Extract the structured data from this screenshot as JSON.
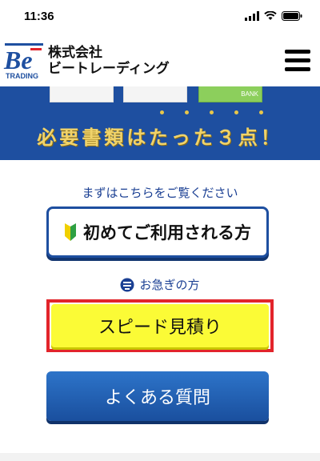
{
  "status_bar": {
    "time": "11:36",
    "icons": [
      "signal-icon",
      "wifi-icon",
      "battery-icon"
    ]
  },
  "header": {
    "logo_text": "Be",
    "logo_subtext": "TRADING",
    "company_line1": "株式会社",
    "company_line2": "ビートレーディング",
    "menu_icon": "hamburger-menu-icon"
  },
  "banner": {
    "text": "必要書類はたった３点！",
    "card_label": "BANK"
  },
  "main": {
    "first_caption": "まずはこちらをご覧ください",
    "first_button": "初めてご利用される方",
    "hurry_label": "お急ぎの方",
    "speed_button": "スピード見積り",
    "faq_button": "よくある質問"
  },
  "colors": {
    "brand_blue": "#1e4fa0",
    "highlight_red": "#e2242b",
    "speed_yellow": "#fbfb36",
    "banner_gold": "#f0d36a"
  }
}
